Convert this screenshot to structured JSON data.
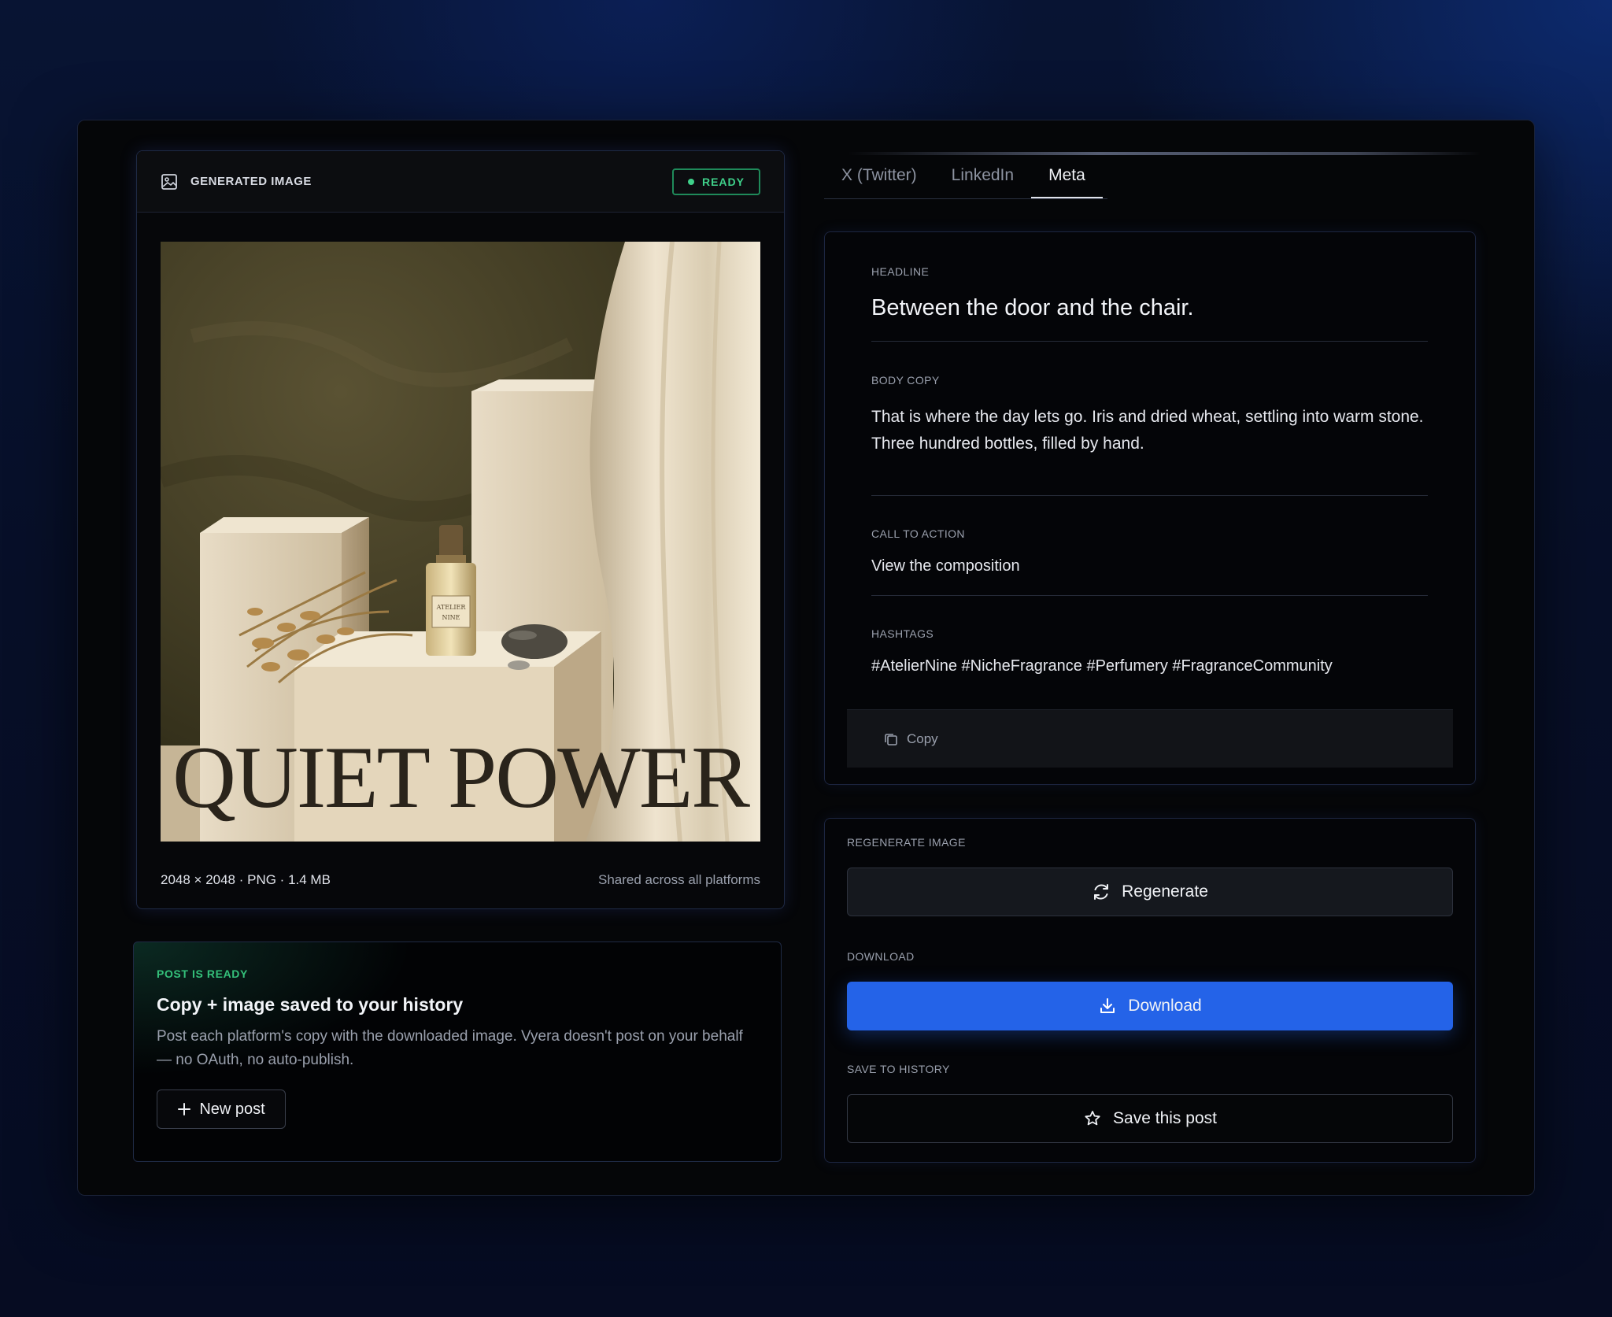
{
  "image_card": {
    "title": "GENERATED IMAGE",
    "status": "READY",
    "image_overlay_text": "QUIET POWER",
    "bottle_label_line1": "ATELIER",
    "bottle_label_line2": "NINE",
    "meta_left": "2048 × 2048 · PNG · 1.4 MB",
    "meta_right": "Shared across all platforms"
  },
  "ready_card": {
    "eyebrow": "POST IS READY",
    "title": "Copy + image saved to your history",
    "description": "Post each platform's copy with the downloaded image. Vyera doesn't post on your behalf — no OAuth, no auto-publish.",
    "new_post_label": "New post"
  },
  "tabs": [
    {
      "label": "X (Twitter)",
      "active": false
    },
    {
      "label": "LinkedIn",
      "active": false
    },
    {
      "label": "Meta",
      "active": true
    }
  ],
  "content": {
    "headline_label": "HEADLINE",
    "headline": "Between the door and the chair.",
    "body_label": "BODY COPY",
    "body": "That is where the day lets go. Iris and dried wheat, settling into warm stone. Three hundred bottles, filled by hand.",
    "cta_label": "CALL TO ACTION",
    "cta": "View the composition",
    "hashtags_label": "HASHTAGS",
    "hashtags": "#AtelierNine #NicheFragrance #Perfumery #FragranceCommunity",
    "copy_label": "Copy"
  },
  "actions": {
    "regenerate_label": "REGENERATE IMAGE",
    "regenerate_button": "Regenerate",
    "download_label": "DOWNLOAD",
    "download_button": "Download",
    "save_label": "SAVE TO HISTORY",
    "save_button": "Save this post"
  },
  "colors": {
    "accent_blue": "#2463e8",
    "ready_green": "#3fd08a",
    "background": "#050608"
  }
}
